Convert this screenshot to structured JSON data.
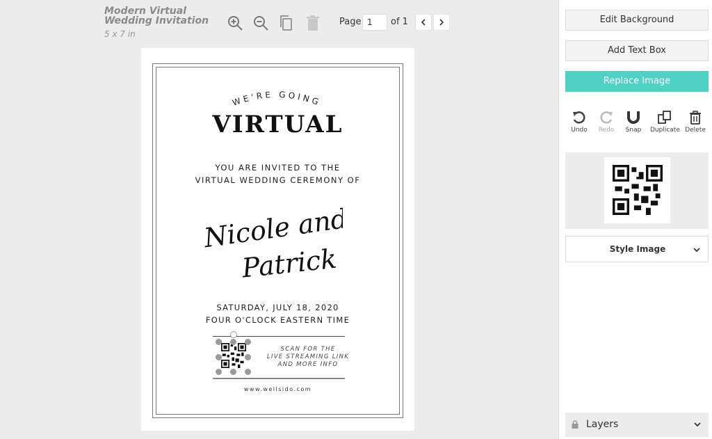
{
  "document": {
    "title": "Modern Virtual Wedding Invitation",
    "size": "5 x 7 in"
  },
  "toolbar": {
    "zoom_in_icon": "zoom-in-icon",
    "zoom_out_icon": "zoom-out-icon",
    "copy_icon": "copy-icon",
    "trash_icon": "trash-icon",
    "page_label": "Page",
    "page_value": "1",
    "page_of": "of 1"
  },
  "invitation": {
    "arc_text": "WE'RE GOING",
    "headline": "VIRTUAL",
    "invite_line_1": "YOU ARE INVITED TO THE",
    "invite_line_2": "VIRTUAL WEDDING CEREMONY OF",
    "names_line_1": "Nicole and",
    "names_line_2": "Patrick",
    "date": "SATURDAY, JULY 18, 2020",
    "time": "FOUR O'CLOCK EASTERN TIME",
    "scan_line_1": "SCAN FOR THE",
    "scan_line_2": "LIVE STREAMING LINK",
    "scan_line_3": "AND MORE INFO",
    "website": "www.wellsido.com"
  },
  "panel": {
    "edit_background": "Edit Background",
    "add_text_box": "Add Text Box",
    "replace_image": "Replace Image",
    "actions": {
      "undo": "Undo",
      "redo": "Redo",
      "snap": "Snap",
      "duplicate": "Duplicate",
      "delete": "Delete"
    },
    "style_image": "Style Image",
    "layers": "Layers"
  },
  "colors": {
    "accent": "#4fd1c5",
    "workspace": "#ececec"
  }
}
